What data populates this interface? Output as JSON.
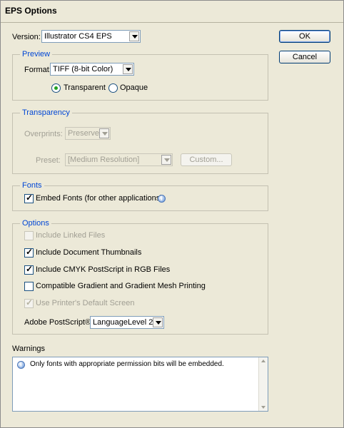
{
  "window": {
    "title": "EPS Options"
  },
  "version": {
    "label": "Version:",
    "value": "Illustrator CS4 EPS"
  },
  "buttons": {
    "ok": "OK",
    "cancel": "Cancel"
  },
  "preview": {
    "legend": "Preview",
    "format_label": "Format:",
    "format_value": "TIFF (8-bit Color)",
    "transparent_label": "Transparent",
    "opaque_label": "Opaque"
  },
  "transparency": {
    "legend": "Transparency",
    "overprints_label": "Overprints:",
    "overprints_value": "Preserve",
    "preset_label": "Preset:",
    "preset_value": "[Medium Resolution]",
    "custom_label": "Custom..."
  },
  "fonts": {
    "legend": "Fonts",
    "embed_label": "Embed Fonts (for other applications)"
  },
  "options": {
    "legend": "Options",
    "include_linked": "Include Linked Files",
    "include_thumbnails": "Include Document Thumbnails",
    "include_cmyk": "Include CMYK PostScript in RGB Files",
    "compatible_gradient": "Compatible Gradient and Gradient Mesh Printing",
    "use_printer_screen": "Use Printer's Default Screen",
    "postscript_label": "Adobe PostScript®:",
    "postscript_value": "LanguageLevel 2"
  },
  "warnings": {
    "legend": "Warnings",
    "message": "Only fonts with appropriate permission bits will be embedded."
  }
}
